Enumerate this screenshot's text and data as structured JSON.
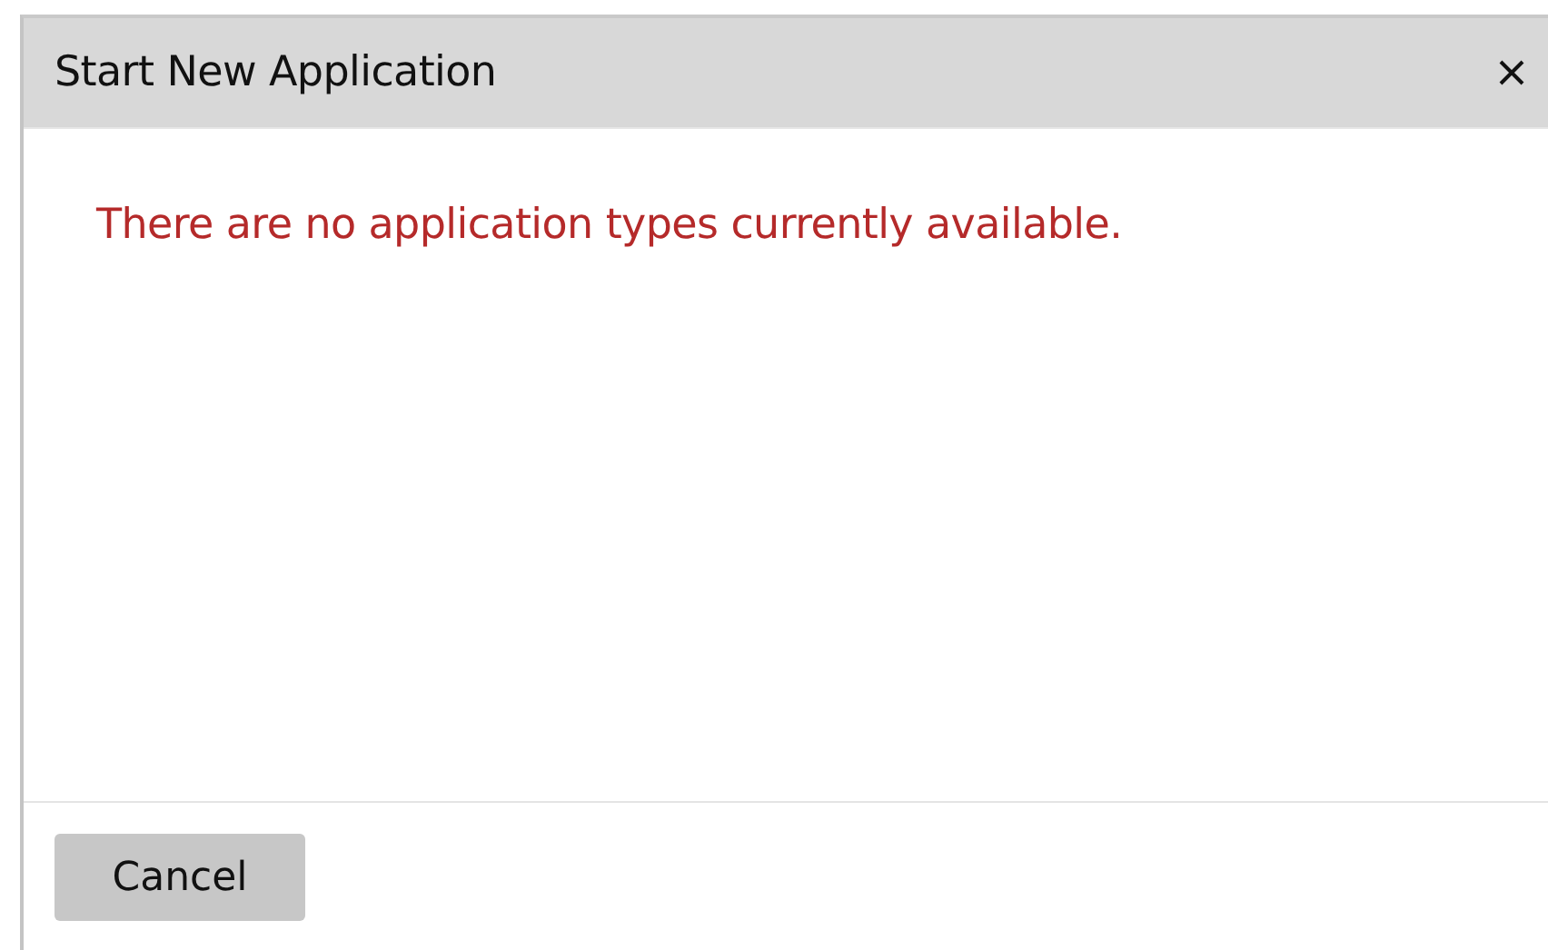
{
  "dialog": {
    "title": "Start New Application",
    "message": "There are no application types currently available.",
    "buttons": [
      "Cancel"
    ]
  }
}
